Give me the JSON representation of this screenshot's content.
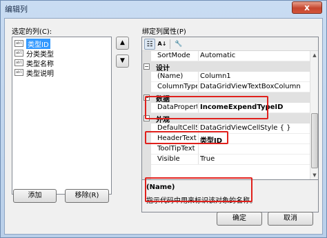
{
  "window": {
    "title": "编辑列",
    "close_symbol": "x"
  },
  "left_panel": {
    "label": "选定的列(C):",
    "columns": [
      {
        "icon_text": "abl",
        "label": "类型ID",
        "selected": true
      },
      {
        "icon_text": "abl",
        "label": "分类类型",
        "selected": false
      },
      {
        "icon_text": "abl",
        "label": "类型名称",
        "selected": false
      },
      {
        "icon_text": "abl",
        "label": "类型说明",
        "selected": false
      }
    ],
    "move_up_symbol": "▲",
    "move_down_symbol": "▼",
    "add_label": "添加",
    "remove_label": "移除(R)"
  },
  "right_panel": {
    "label": "绑定列属性(P)",
    "toolbar": {
      "categorized": "☷",
      "alphabetical": "A↓",
      "property_pages": "🔧"
    },
    "rows": [
      {
        "kind": "prop",
        "name": "SortMode",
        "value": "Automatic",
        "bold": false
      },
      {
        "kind": "cat",
        "name": "设计",
        "toggle": "−"
      },
      {
        "kind": "prop",
        "name": "(Name)",
        "value": "Column1",
        "bold": false
      },
      {
        "kind": "prop",
        "name": "ColumnType",
        "value": "DataGridViewTextBoxColumn",
        "bold": false
      },
      {
        "kind": "cat",
        "name": "数据",
        "toggle": "−"
      },
      {
        "kind": "prop",
        "name": "DataPropertyName",
        "value": "IncomeExpendTypeID",
        "bold": true
      },
      {
        "kind": "cat",
        "name": "外观",
        "toggle": "−"
      },
      {
        "kind": "prop",
        "name": "DefaultCellStyle",
        "value": "DataGridViewCellStyle { }",
        "bold": false
      },
      {
        "kind": "prop",
        "name": "HeaderText",
        "value": "类型ID",
        "bold": true
      },
      {
        "kind": "prop",
        "name": "ToolTipText",
        "value": "",
        "bold": false
      },
      {
        "kind": "prop",
        "name": "Visible",
        "value": "True",
        "bold": false
      }
    ],
    "description": {
      "title": "(Name)",
      "text": "指示代码中用来标识该对象的名称。"
    }
  },
  "footer": {
    "ok_label": "确定",
    "cancel_label": "取消"
  },
  "colors": {
    "highlight": "#e0201c",
    "selection": "#3399ff"
  }
}
